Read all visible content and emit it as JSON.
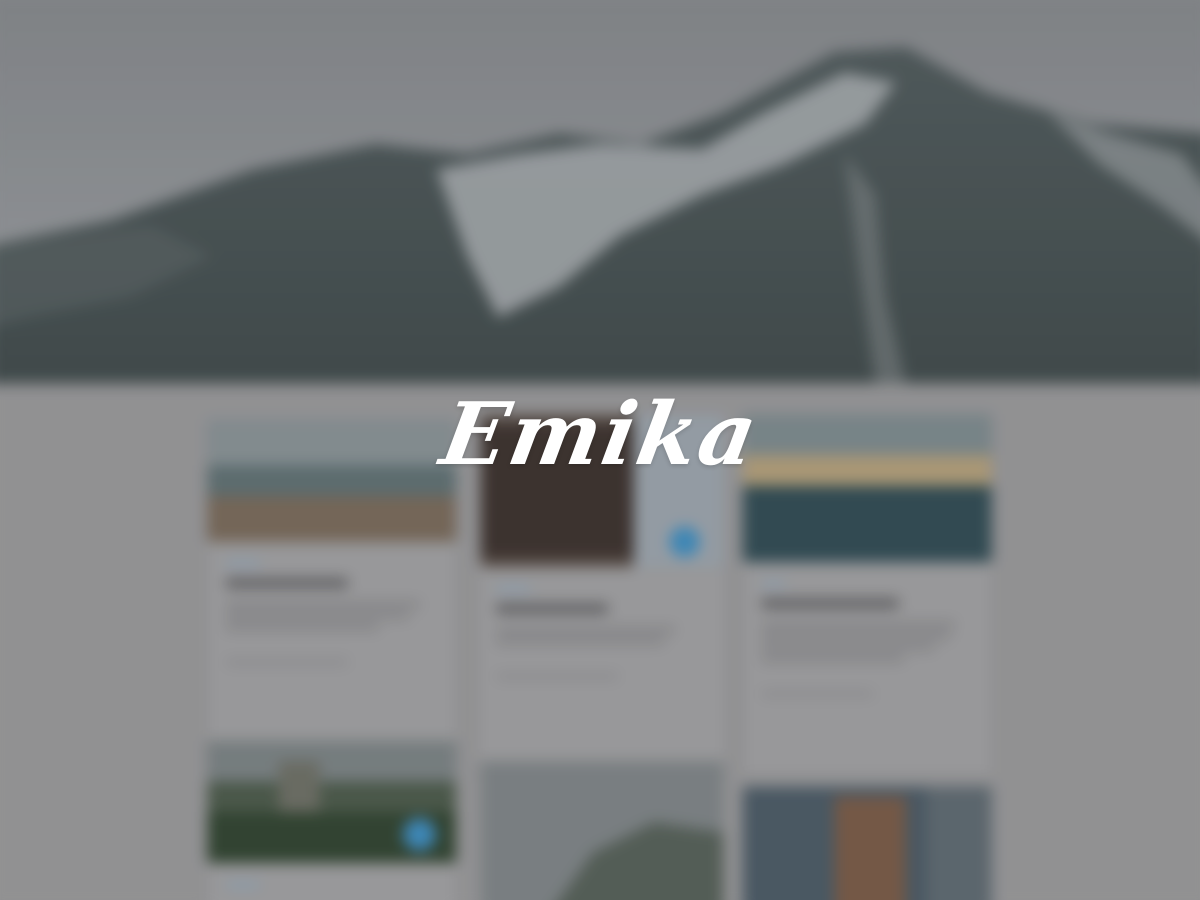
{
  "brand": {
    "logo_text": "Emika",
    "logo_color": "#ffffff"
  },
  "background": {
    "state": "blurred",
    "hero_image": "snowy-mountain-photo",
    "cards": [
      {
        "image": "coastline-photo"
      },
      {
        "image": "interior-photo"
      },
      {
        "image": "sunset-sea-photo"
      },
      {
        "image": "green-castle-photo"
      },
      {
        "image": "misty-cliff-photo"
      },
      {
        "image": "portrait-photo"
      }
    ]
  }
}
